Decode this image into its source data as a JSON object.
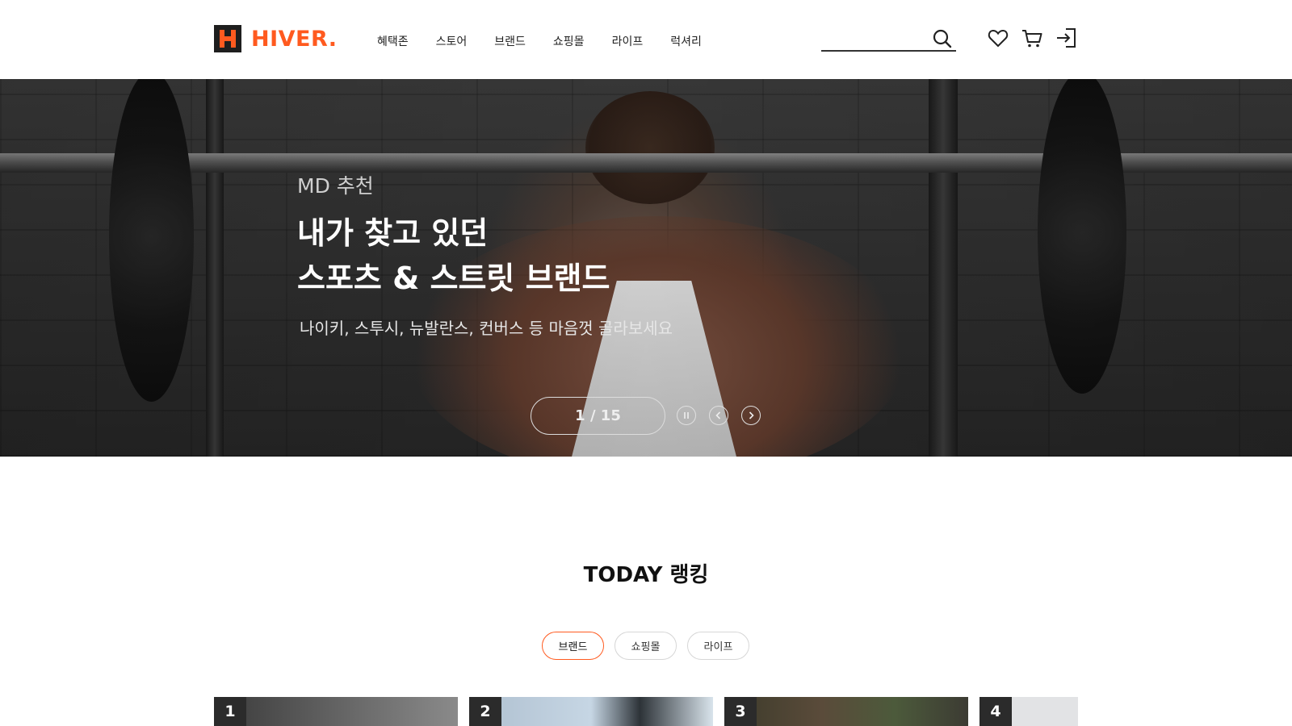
{
  "brand": {
    "name": "HIVER.",
    "accent": "#ff5a1f"
  },
  "nav": {
    "items": [
      {
        "label": "혜택존"
      },
      {
        "label": "스토어"
      },
      {
        "label": "브랜드"
      },
      {
        "label": "쇼핑몰"
      },
      {
        "label": "라이프"
      },
      {
        "label": "럭셔리"
      }
    ]
  },
  "search": {
    "value": "",
    "placeholder": ""
  },
  "header_icons": [
    "search-icon",
    "heart-icon",
    "cart-icon",
    "login-icon"
  ],
  "hero": {
    "eyebrow": "MD 추천",
    "title_line1": "내가 찾고 있던",
    "title_line2": "스포츠 & 스트릿 브랜드",
    "description": "나이키, 스투시, 뉴발란스, 컨버스 등 마음껏 골라보세요",
    "pager": "1 / 15",
    "controls": [
      "pause-icon",
      "chevron-left-icon",
      "chevron-right-icon"
    ]
  },
  "ranking": {
    "title": "TODAY 랭킹",
    "tabs": [
      {
        "label": "브랜드",
        "active": true
      },
      {
        "label": "쇼핑몰",
        "active": false
      },
      {
        "label": "라이프",
        "active": false
      }
    ],
    "cards": [
      {
        "rank": "1"
      },
      {
        "rank": "2"
      },
      {
        "rank": "3"
      },
      {
        "rank": "4"
      }
    ]
  }
}
